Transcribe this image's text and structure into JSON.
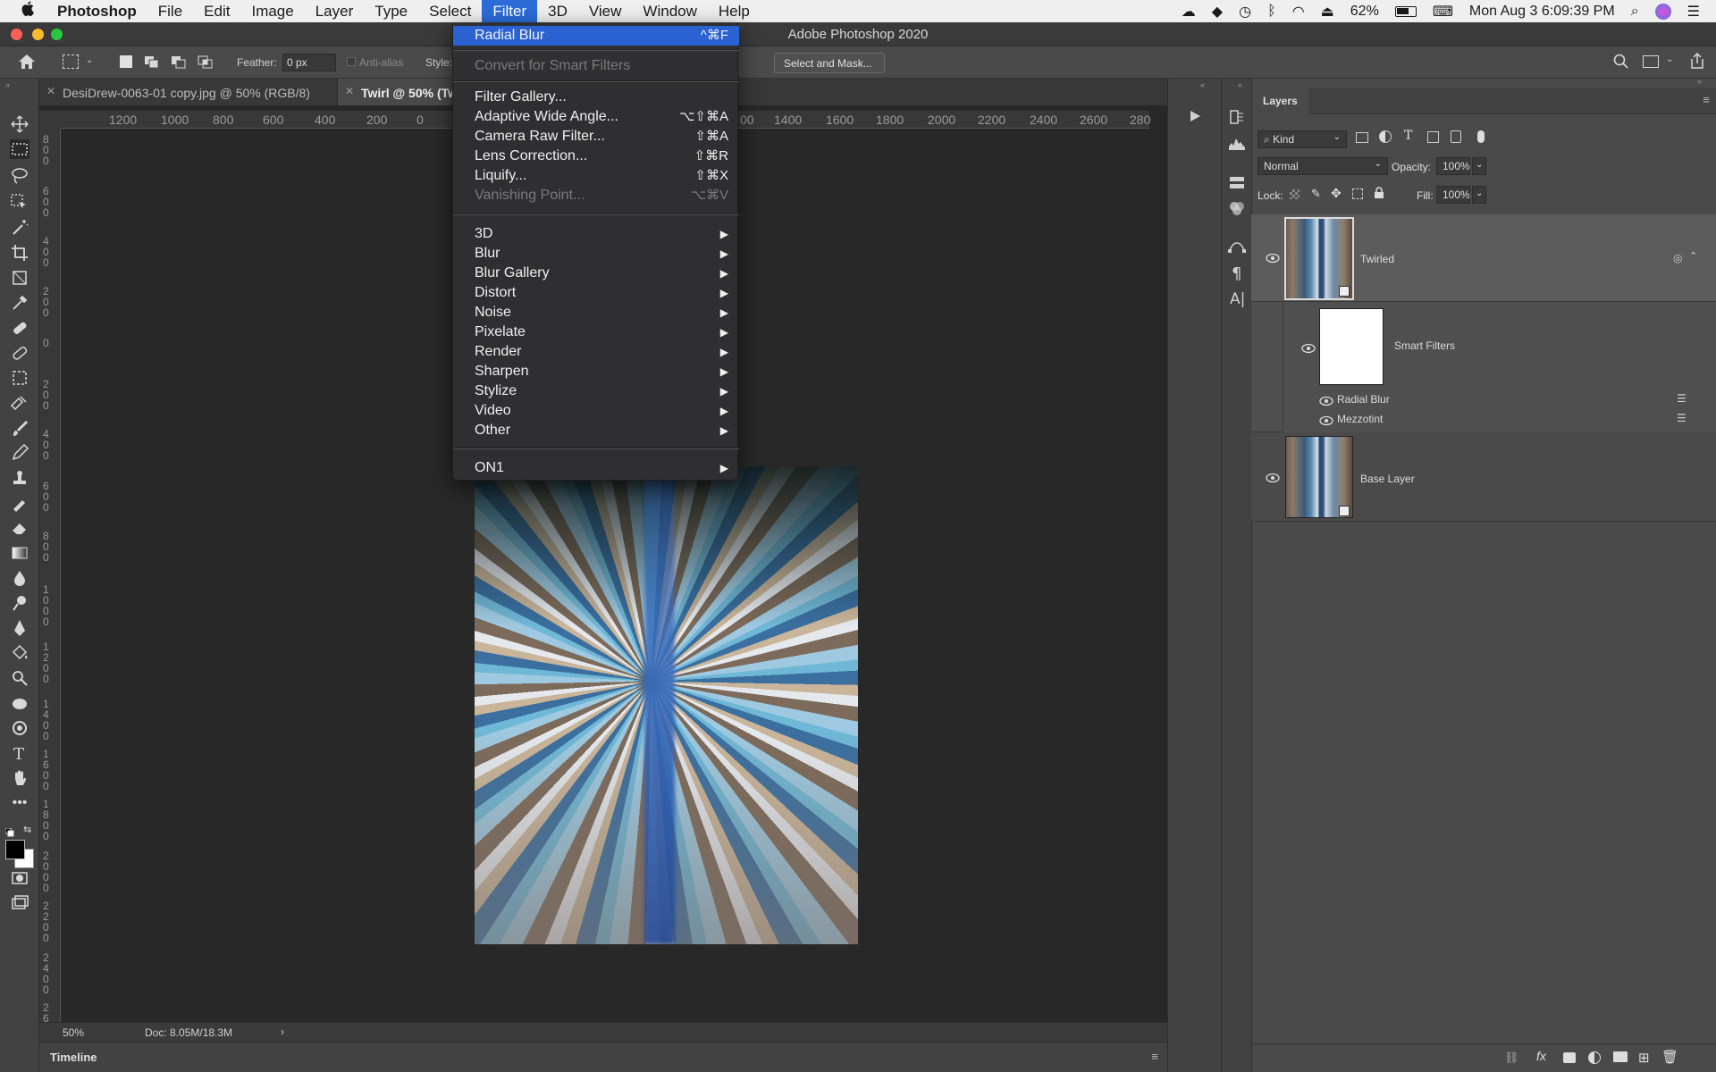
{
  "menubar": {
    "app_name": "Photoshop",
    "items": [
      "File",
      "Edit",
      "Image",
      "Layer",
      "Type",
      "Select",
      "Filter",
      "3D",
      "View",
      "Window",
      "Help"
    ],
    "battery": "62%",
    "clock": "Mon Aug 3  6:09:39 PM"
  },
  "window": {
    "title": "Adobe Photoshop 2020"
  },
  "options": {
    "feather_label": "Feather:",
    "feather_value": "0 px",
    "antialias_label": "Anti-alias",
    "style_label": "Style:",
    "select_mask_label": "Select and Mask..."
  },
  "tabs": [
    {
      "label": "DesiDrew-0063-01 copy.jpg @ 50% (RGB/8)"
    },
    {
      "label": "Twirl @ 50% (Tw"
    }
  ],
  "ruler_h": [
    "1200",
    "1000",
    "800",
    "600",
    "400",
    "200",
    "0",
    "00",
    "1400",
    "1600",
    "1800",
    "2000",
    "2200",
    "2400",
    "2600",
    "280"
  ],
  "ruler_v": [
    "8\n0\n0",
    "6\n0\n0",
    "4\n0\n0",
    "2\n0\n0",
    "0",
    "2\n0\n0",
    "4\n0\n0",
    "6\n0\n0",
    "8\n0\n0",
    "1\n0\n0\n0",
    "1\n2\n0\n0",
    "1\n4\n0\n0",
    "1\n6\n0\n0",
    "1\n8\n0\n0",
    "2\n0\n0\n0",
    "2\n2\n0\n0",
    "2\n4\n0\n0",
    "2\n6"
  ],
  "status": {
    "zoom": "50%",
    "doc": "Doc: 8.05M/18.3M"
  },
  "timeline": {
    "label": "Timeline"
  },
  "filter_menu": {
    "items": [
      {
        "label": "Radial Blur",
        "shortcut": "^⌘F",
        "highlighted": true
      },
      {
        "label": "Convert for Smart Filters",
        "disabled": true
      },
      {
        "label": "Filter Gallery..."
      },
      {
        "label": "Adaptive Wide Angle...",
        "shortcut": "⌥⇧⌘A"
      },
      {
        "label": "Camera Raw Filter...",
        "shortcut": "⇧⌘A"
      },
      {
        "label": "Lens Correction...",
        "shortcut": "⇧⌘R"
      },
      {
        "label": "Liquify...",
        "shortcut": "⇧⌘X"
      },
      {
        "label": "Vanishing Point...",
        "shortcut": "⌥⌘V",
        "disabled": true
      },
      {
        "label": "3D"
      },
      {
        "label": "Blur"
      },
      {
        "label": "Blur Gallery"
      },
      {
        "label": "Distort"
      },
      {
        "label": "Noise"
      },
      {
        "label": "Pixelate"
      },
      {
        "label": "Render"
      },
      {
        "label": "Sharpen"
      },
      {
        "label": "Stylize"
      },
      {
        "label": "Video"
      },
      {
        "label": "Other"
      },
      {
        "label": "ON1"
      }
    ]
  },
  "layers_panel": {
    "title": "Layers",
    "kind_label": "Kind",
    "blend_mode": "Normal",
    "opacity_label": "Opacity:",
    "opacity_value": "100%",
    "lock_label": "Lock:",
    "fill_label": "Fill:",
    "fill_value": "100%",
    "layers": [
      {
        "name": "Twirled",
        "selected": true
      },
      {
        "name": "Smart Filters"
      },
      {
        "name": "Radial Blur"
      },
      {
        "name": "Mezzotint"
      },
      {
        "name": "Base Layer"
      }
    ]
  },
  "colors": {
    "accent": "#2a63d1",
    "panel": "#4a4a4a",
    "canvas_bg": "#282828"
  }
}
